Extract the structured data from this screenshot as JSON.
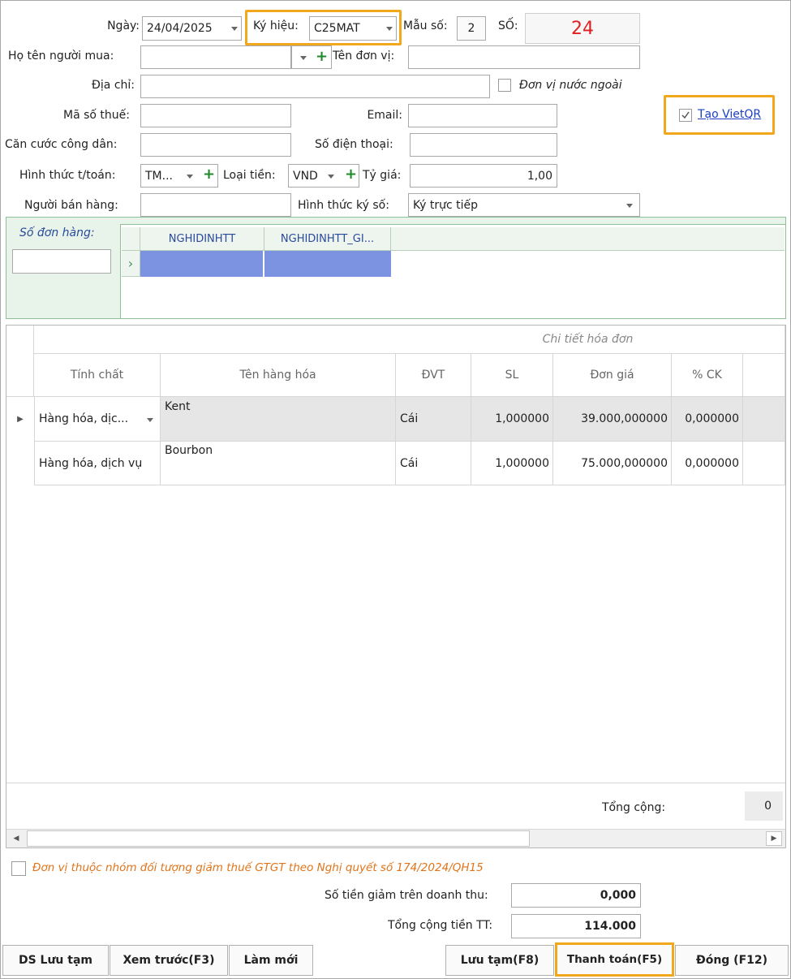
{
  "header": {
    "ngay_label": "Ngày:",
    "ngay_value": "24/04/2025",
    "kyhieu_label": "Ký hiệu:",
    "kyhieu_value": "C25MAT",
    "mauso_label": "Mẫu số:",
    "mauso_value": "2",
    "so_label": "SỐ:",
    "so_value": "24"
  },
  "form": {
    "ho_ten_label": "Họ tên người mua:",
    "ten_don_vi_label": "Tên đơn vị:",
    "dia_chi_label": "Địa chỉ:",
    "don_vi_nuoc_ngoai_label": "Đơn vị nước ngoài",
    "ma_so_thue_label": "Mã số thuế:",
    "email_label": "Email:",
    "tao_vietqr_label": "Tạo VietQR",
    "can_cuoc_label": "Căn cước công dân:",
    "so_dien_thoai_label": "Số điện thoại:",
    "hinh_thuc_tt_label": "Hình thức t/toán:",
    "hinh_thuc_tt_value": "TM...",
    "loai_tien_label": "Loại tiền:",
    "loai_tien_value": "VND",
    "ty_gia_label": "Tỷ giá:",
    "ty_gia_value": "1,00",
    "nguoi_ban_label": "Người bán hàng:",
    "hinh_thuc_ky_so_label": "Hình thức ký số:",
    "hinh_thuc_ky_so_value": "Ký trực tiếp"
  },
  "orders": {
    "so_don_hang_label": "Số đơn hàng:",
    "columns": [
      "NGHIDINHTT",
      "NGHIDINHTT_GI..."
    ]
  },
  "detail": {
    "group_header": "Chi tiết hóa đơn",
    "columns": [
      "Tính chất",
      "Tên hàng hóa",
      "ĐVT",
      "SL",
      "Đơn giá",
      "% CK"
    ],
    "rows": [
      {
        "tinh_chat": "Hàng hóa, dịc...",
        "ten": "Kent",
        "dvt": "Cái",
        "sl": "1,000000",
        "don_gia": "39.000,000000",
        "ck": "0,000000"
      },
      {
        "tinh_chat": "Hàng hóa, dịch vụ",
        "ten": "Bourbon",
        "dvt": "Cái",
        "sl": "1,000000",
        "don_gia": "75.000,000000",
        "ck": "0,000000"
      }
    ],
    "tong_cong_label": "Tổng cộng:",
    "tong_cong_value": "0"
  },
  "footer": {
    "giam_thue_label": "Đơn vị thuộc nhóm đối tượng giảm thuế GTGT theo Nghị quyết số 174/2024/QH15",
    "so_tien_giam_label": "Số tiền giảm trên doanh thu:",
    "so_tien_giam_value": "0,000",
    "tong_cong_tt_label": "Tổng cộng tiền TT:",
    "tong_cong_tt_value": "114.000"
  },
  "buttons": {
    "ds_luu_tam": "DS Lưu tạm",
    "xem_truoc": "Xem trước(F3)",
    "lam_moi": "Làm mới",
    "luu_tam": "Lưu tạm(F8)",
    "thanh_toan": "Thanh toán(F5)",
    "dong": "Đóng (F12)"
  },
  "colors": {
    "highlight": "#f2a81d",
    "so_value": "#e02020",
    "link": "#1a3fc0",
    "orange_text": "#e0741a",
    "selected_cell": "#7b93e0"
  }
}
